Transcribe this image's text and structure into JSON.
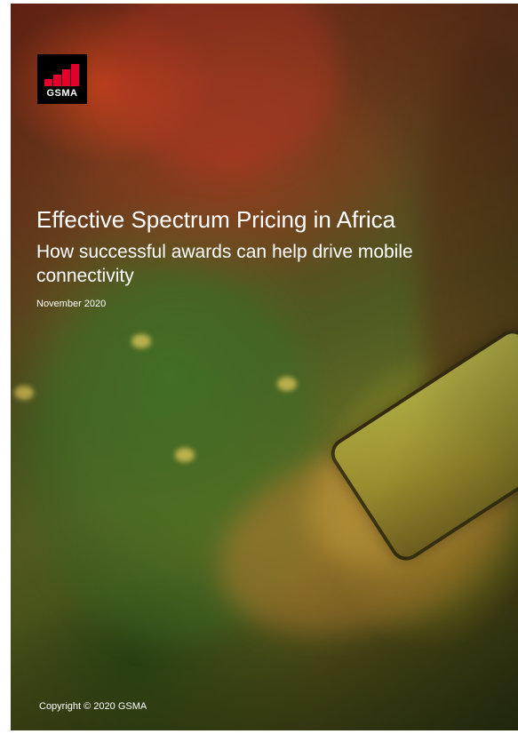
{
  "cover": {
    "logo_text": "GSMA",
    "title": "Effective Spectrum Pricing in Africa",
    "subtitle": "How successful awards can help drive mobile connectivity",
    "date": "November 2020",
    "copyright": "Copyright © 2020 GSMA"
  },
  "colors": {
    "logo_background": "#000000",
    "logo_bars": "#e4002b",
    "text": "#ffffff"
  }
}
